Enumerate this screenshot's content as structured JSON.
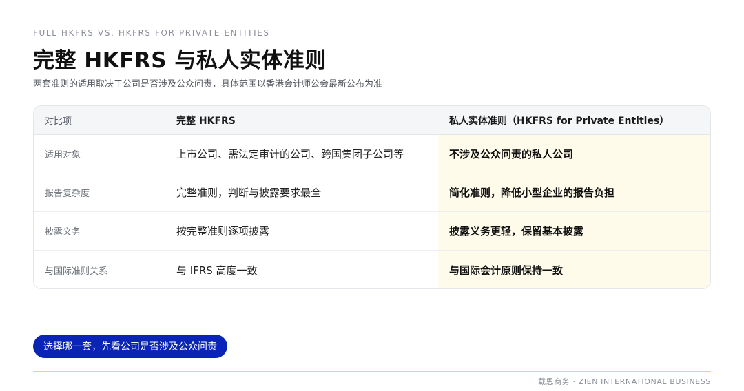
{
  "header": {
    "eyebrow": "FULL HKFRS VS. HKFRS FOR PRIVATE ENTITIES",
    "title": "完整 HKFRS 与私人实体准则",
    "subtitle": "两套准则的适用取决于公司是否涉及公众问责，具体范围以香港会计师公会最新公布为准"
  },
  "table": {
    "headers": [
      "对比项",
      "完整 HKFRS",
      "私人实体准则（HKFRS for Private Entities）"
    ],
    "rows": [
      [
        "适用对象",
        "上市公司、需法定审计的公司、跨国集团子公司等",
        "不涉及公众问责的私人公司"
      ],
      [
        "报告复杂度",
        "完整准则，判断与披露要求最全",
        "简化准则，降低小型企业的报告负担"
      ],
      [
        "披露义务",
        "按完整准则逐项披露",
        "披露义务更轻，保留基本披露"
      ],
      [
        "与国际准则关系",
        "与 IFRS 高度一致",
        "与国际会计原则保持一致"
      ]
    ]
  },
  "callout": {
    "label": "选择哪一套，先看公司是否涉及公众问责"
  },
  "footer": {
    "brand": "载恩商务 · ZIEN INTERNATIONAL BUSINESS"
  },
  "colors": {
    "accent": "#0a24b5",
    "highlight": "#fefbea",
    "rule": "#f0d94a"
  }
}
